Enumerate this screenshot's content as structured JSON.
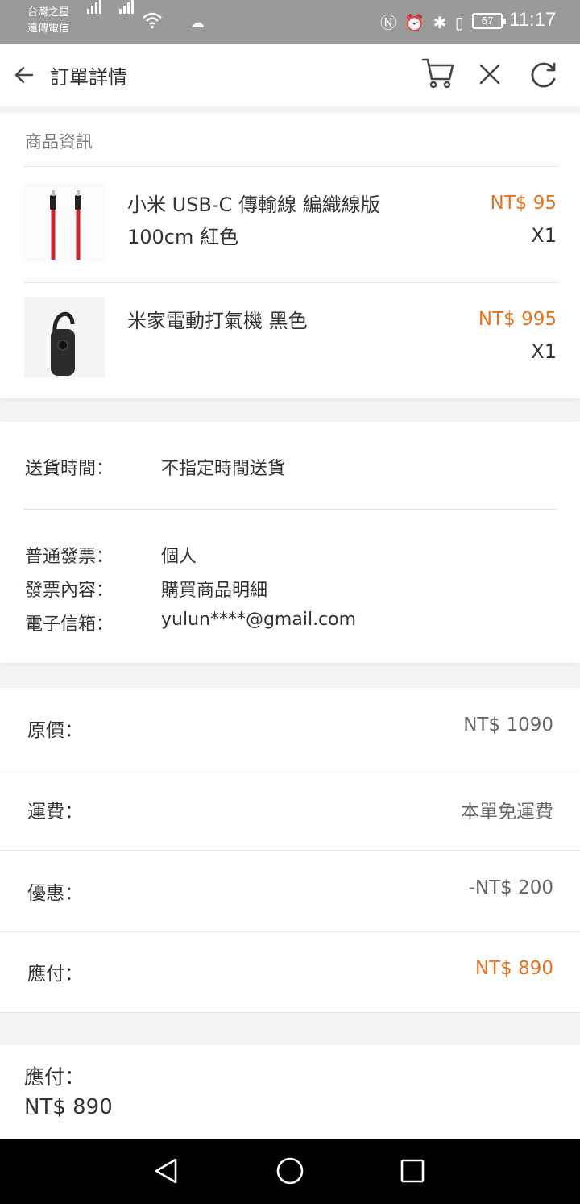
{
  "status_bar": {
    "carrier_line1": "台灣之星",
    "carrier_line2": "遠傳電信",
    "battery": "67",
    "time": "11:17"
  },
  "header": {
    "title": "訂單詳情",
    "icons": [
      "back-arrow-icon",
      "cart-icon",
      "close-icon",
      "refresh-icon"
    ]
  },
  "product_section": {
    "label": "商品資訊",
    "items": [
      {
        "name": "小米 USB-C 傳輸線 編織線版 100cm 紅色",
        "price": "NT$ 95",
        "qty": "X1"
      },
      {
        "name": "米家電動打氣機 黑色",
        "price": "NT$ 995",
        "qty": "X1"
      }
    ]
  },
  "delivery": {
    "time_key": "送貨時間：",
    "time_value": "不指定時間送貨"
  },
  "invoice": {
    "type_key": "普通發票：",
    "type_value": "個人",
    "content_key": "發票內容：",
    "content_value": "購買商品明細",
    "email_key": "電子信箱：",
    "email_value": "yulun****@gmail.com"
  },
  "pricing": {
    "original_key": "原價：",
    "original_value": "NT$ 1090",
    "shipping_key": "運費：",
    "shipping_value": "本單免運費",
    "discount_key": "優惠：",
    "discount_value": "-NT$ 200",
    "payable_key": "應付：",
    "payable_value": "NT$ 890"
  },
  "bottom_bar": {
    "label": "應付：",
    "total": "NT$ 890"
  },
  "colors": {
    "accent": "#e8731e",
    "status_bar": "#9a9a9a",
    "background": "#f4f4f4"
  }
}
